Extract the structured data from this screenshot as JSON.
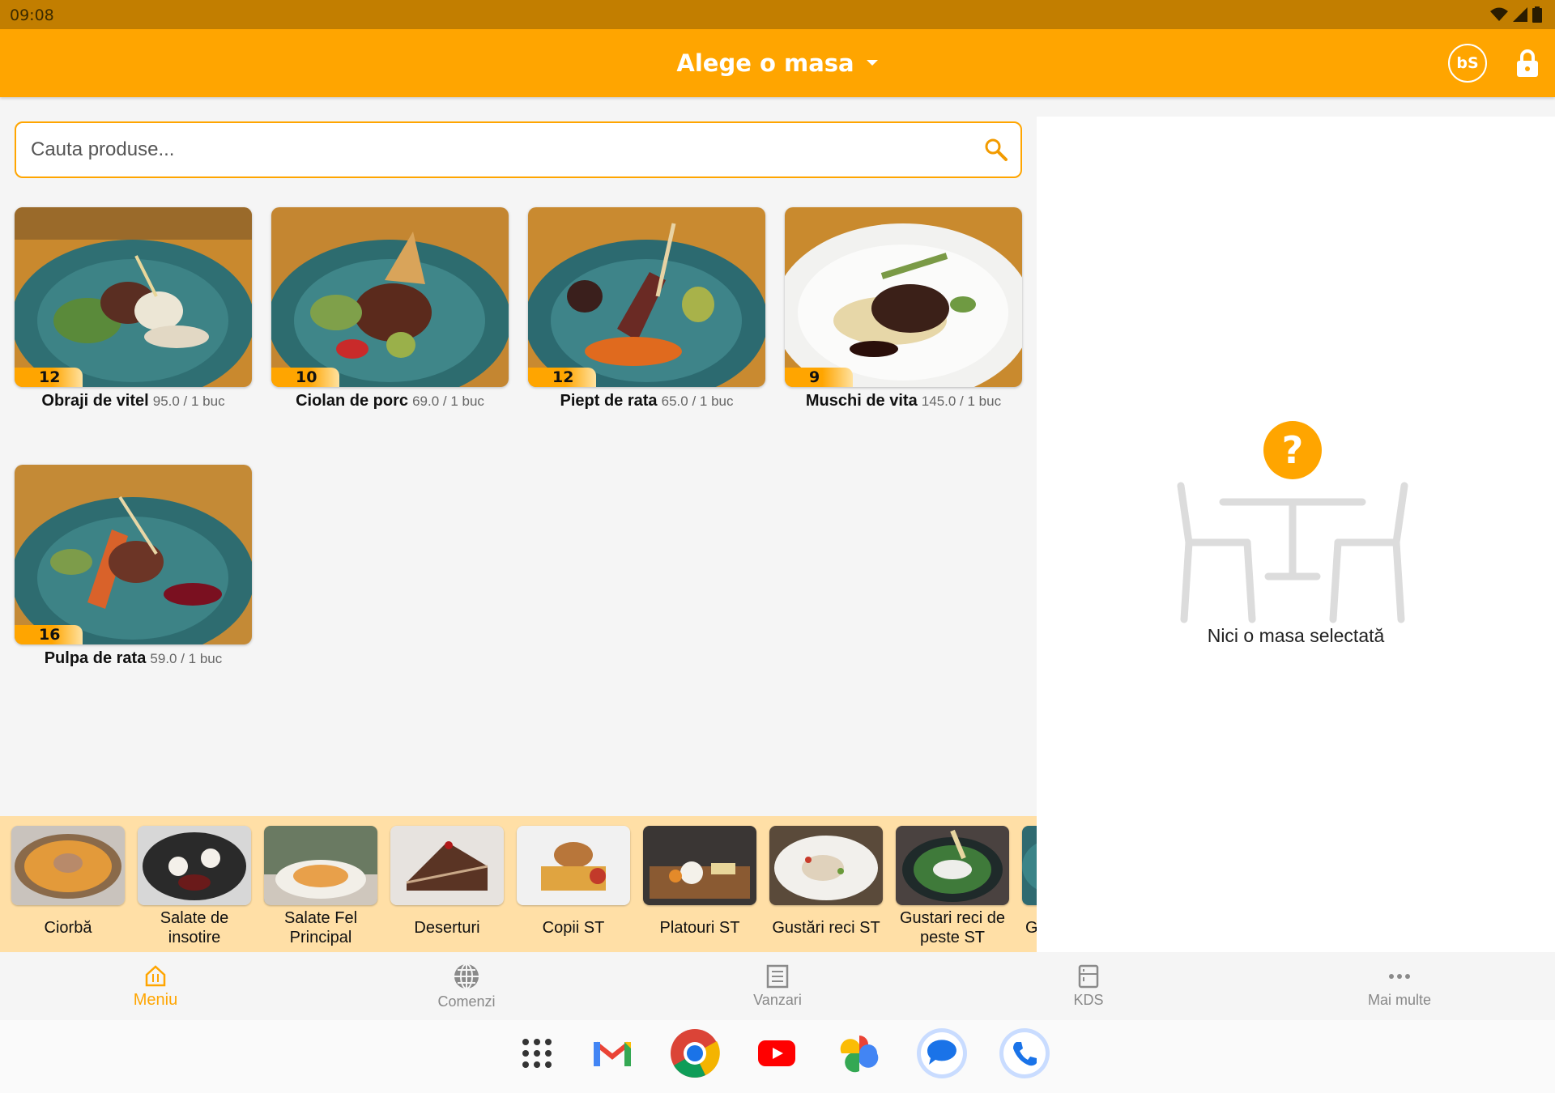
{
  "status_bar": {
    "time": "09:08"
  },
  "app_bar": {
    "table_picker_label": "Alege o masa",
    "user_initials": "bS",
    "accent_color": "#ffa500"
  },
  "search": {
    "placeholder": "Cauta produse..."
  },
  "products": [
    {
      "name": "Obraji de vitel",
      "price": "95.0 / 1 buc",
      "stock": "12"
    },
    {
      "name": "Ciolan de porc",
      "price": "69.0 / 1 buc",
      "stock": "10"
    },
    {
      "name": "Piept de rata",
      "price": "65.0 / 1 buc",
      "stock": "12"
    },
    {
      "name": "Muschi de vita",
      "price": "145.0 / 1 buc",
      "stock": "9"
    },
    {
      "name": "Pulpa de rata",
      "price": "59.0 / 1 buc",
      "stock": "16"
    }
  ],
  "right_panel": {
    "empty_text": "Nici o masa selectată",
    "icon": "table-question-icon"
  },
  "categories": [
    {
      "label": "Ciorbă"
    },
    {
      "label": "Salate de insotire"
    },
    {
      "label": "Salate Fel Principal"
    },
    {
      "label": "Deserturi"
    },
    {
      "label": "Copii ST"
    },
    {
      "label": "Platouri ST"
    },
    {
      "label": "Gustări reci ST"
    },
    {
      "label": "Gustari reci de peste ST"
    },
    {
      "label": "G"
    }
  ],
  "bottom_nav": [
    {
      "label": "Meniu",
      "icon": "menu-house-icon",
      "active": true
    },
    {
      "label": "Comenzi",
      "icon": "globe-icon",
      "active": false
    },
    {
      "label": "Vanzari",
      "icon": "receipt-icon",
      "active": false
    },
    {
      "label": "KDS",
      "icon": "kitchen-display-icon",
      "active": false
    },
    {
      "label": "Mai multe",
      "icon": "more-dots-icon",
      "active": false
    }
  ],
  "dock": [
    {
      "icon": "app-drawer-icon"
    },
    {
      "icon": "gmail-icon"
    },
    {
      "icon": "chrome-icon"
    },
    {
      "icon": "youtube-icon"
    },
    {
      "icon": "photos-icon"
    },
    {
      "icon": "messages-icon"
    },
    {
      "icon": "phone-icon"
    }
  ]
}
